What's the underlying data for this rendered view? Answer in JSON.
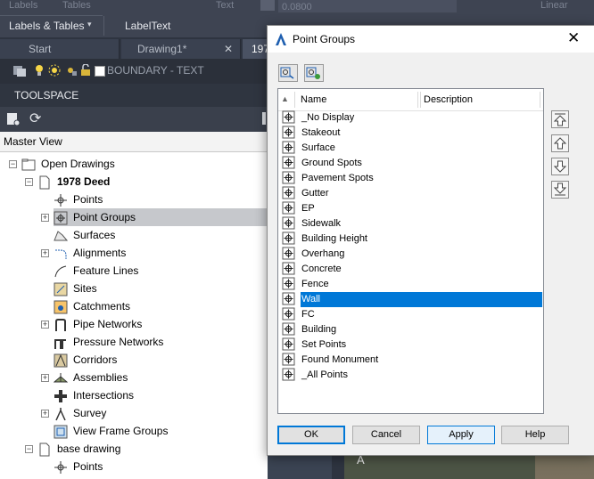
{
  "ribbon": {
    "ghost_labels": [
      "Labels",
      "Tables",
      "Text",
      "0.0800",
      "Linear"
    ],
    "panel_labels": [
      "Labels & Tables",
      "LabelText",
      "Text"
    ]
  },
  "tabs": [
    {
      "label": "Start"
    },
    {
      "label": "Drawing1*"
    },
    {
      "label": "197"
    }
  ],
  "layer": {
    "name": "BOUNDARY - TEXT"
  },
  "toolspace": {
    "title": "TOOLSPACE",
    "view_tab": "Master View",
    "tree": [
      {
        "label": "Open Drawings",
        "bold": false
      },
      {
        "label": "1978 Deed",
        "bold": true
      },
      {
        "label": "Points"
      },
      {
        "label": "Point Groups",
        "selected": true
      },
      {
        "label": "Surfaces"
      },
      {
        "label": "Alignments"
      },
      {
        "label": "Feature Lines"
      },
      {
        "label": "Sites"
      },
      {
        "label": "Catchments"
      },
      {
        "label": "Pipe Networks"
      },
      {
        "label": "Pressure Networks"
      },
      {
        "label": "Corridors"
      },
      {
        "label": "Assemblies"
      },
      {
        "label": "Intersections"
      },
      {
        "label": "Survey"
      },
      {
        "label": "View Frame Groups"
      },
      {
        "label": "base drawing",
        "bold": false
      },
      {
        "label": "Points"
      }
    ]
  },
  "dialog": {
    "title": "Point Groups",
    "columns": {
      "name": "Name",
      "description": "Description"
    },
    "groups": [
      {
        "name": "_No Display"
      },
      {
        "name": "Stakeout"
      },
      {
        "name": "Surface"
      },
      {
        "name": "Ground Spots"
      },
      {
        "name": "Pavement Spots"
      },
      {
        "name": "Gutter"
      },
      {
        "name": "EP"
      },
      {
        "name": "Sidewalk"
      },
      {
        "name": "Building Height"
      },
      {
        "name": "Overhang"
      },
      {
        "name": "Concrete"
      },
      {
        "name": "Fence"
      },
      {
        "name": "Wall",
        "selected": true
      },
      {
        "name": "FC"
      },
      {
        "name": "Building"
      },
      {
        "name": "Set Points"
      },
      {
        "name": "Found Monument"
      },
      {
        "name": "_All Points"
      }
    ],
    "buttons": {
      "ok": "OK",
      "cancel": "Cancel",
      "apply": "Apply",
      "help": "Help"
    }
  },
  "colors": {
    "selection": "#0078d7",
    "tree_selection": "#c6c8cc"
  }
}
